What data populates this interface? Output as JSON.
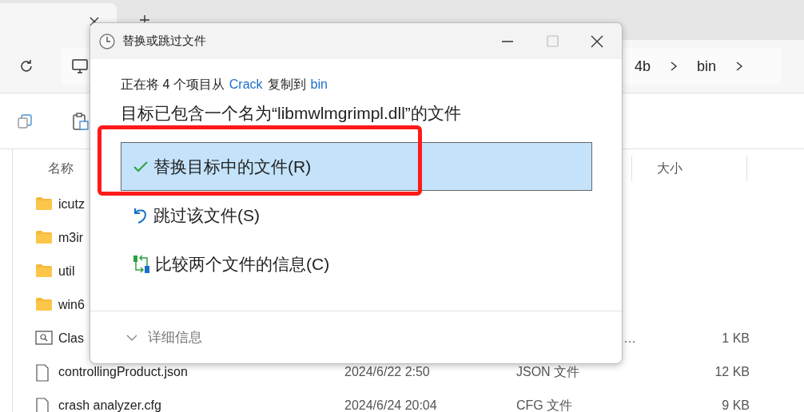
{
  "explorer": {
    "breadcrumb": [
      "4b",
      "bin"
    ],
    "columns": [
      "名称",
      "大小"
    ],
    "rows": [
      {
        "kind": "folder",
        "name": "icutz"
      },
      {
        "kind": "folder",
        "name": "m3ir"
      },
      {
        "kind": "folder",
        "name": "util"
      },
      {
        "kind": "folder",
        "name": "win6"
      },
      {
        "kind": "config",
        "name": "Clas",
        "type": "…",
        "size": "1 KB"
      },
      {
        "kind": "file",
        "name": "controllingProduct.json",
        "date": "2024/6/22 2:50",
        "type": "JSON 文件",
        "size": "12 KB"
      },
      {
        "kind": "file",
        "name": "crash analyzer.cfg",
        "date": "2024/6/24 20:04",
        "type": "CFG 文件",
        "size": "9 KB"
      }
    ]
  },
  "dialog": {
    "title": "替换或跳过文件",
    "status": [
      {
        "kind": "text",
        "text": "正在将 4 个项目从"
      },
      {
        "kind": "link",
        "text": "Crack"
      },
      {
        "kind": "text",
        "text": "复制到"
      },
      {
        "kind": "link",
        "text": "bin"
      }
    ],
    "message": "目标已包含一个名为“libmwlmgrimpl.dll”的文件",
    "options": [
      {
        "kind": "replace",
        "label": "替换目标中的文件(R)",
        "selected": true,
        "highlighted": true
      },
      {
        "kind": "skip",
        "label": "跳过该文件(S)",
        "selected": false,
        "highlighted": false
      },
      {
        "kind": "compare",
        "label": "比较两个文件的信息(C)",
        "selected": false,
        "highlighted": false
      }
    ],
    "details": "详细信息"
  }
}
